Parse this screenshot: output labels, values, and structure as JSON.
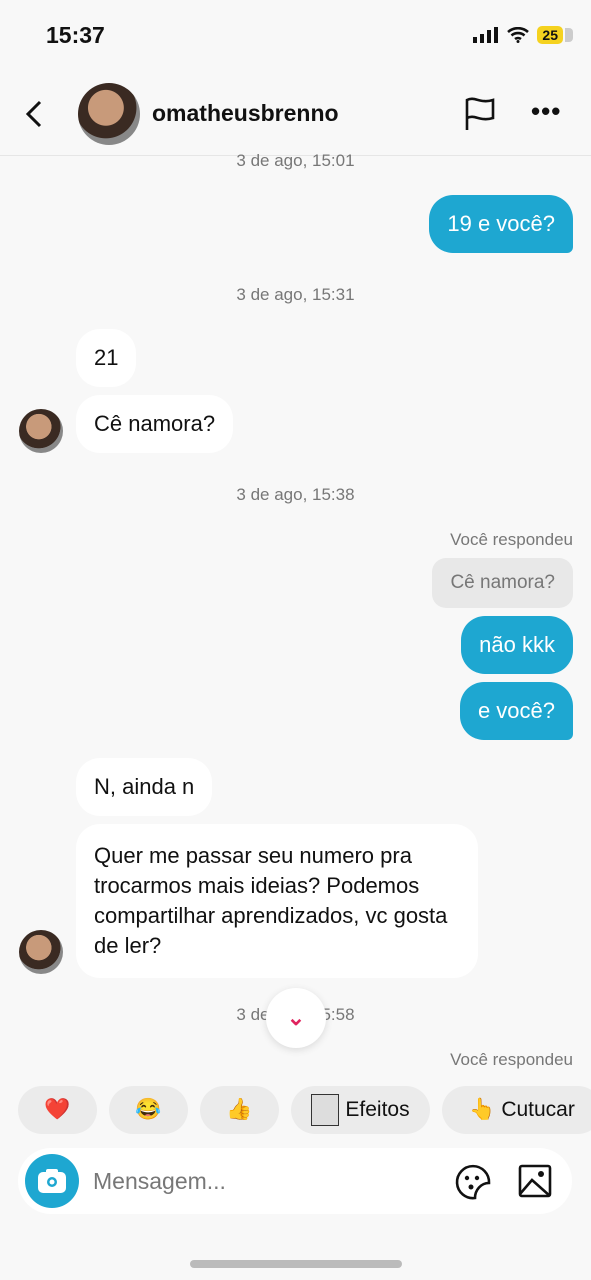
{
  "status": {
    "time": "15:37",
    "battery": "25"
  },
  "header": {
    "username": "omatheusbrenno"
  },
  "messages": {
    "ts1": "3 de ago, 15:01",
    "m1": "19 e você?",
    "ts2": "3 de ago, 15:31",
    "m2": "21",
    "m3": "Cê namora?",
    "ts3": "3 de ago, 15:38",
    "reply1": "Você respondeu",
    "quote1": "Cê namora?",
    "m4": "não kkk",
    "m5": "e você?",
    "m6": "N, ainda n",
    "m7": "Quer me passar seu numero pra trocarmos mais ideias? Podemos compartilhar aprendizados, vc gosta de ler?",
    "ts4": "3 de ago, 15:58",
    "reply2": "Você respondeu"
  },
  "quick": {
    "heart": "❤️",
    "laugh": "😂",
    "thumb": "👍",
    "effects": "Efeitos",
    "poke_emoji": "👆",
    "poke": "Cutucar"
  },
  "composer": {
    "placeholder": "Mensagem..."
  },
  "colors": {
    "outgoing": "#1ea7d1",
    "accent": "#e0245e"
  }
}
